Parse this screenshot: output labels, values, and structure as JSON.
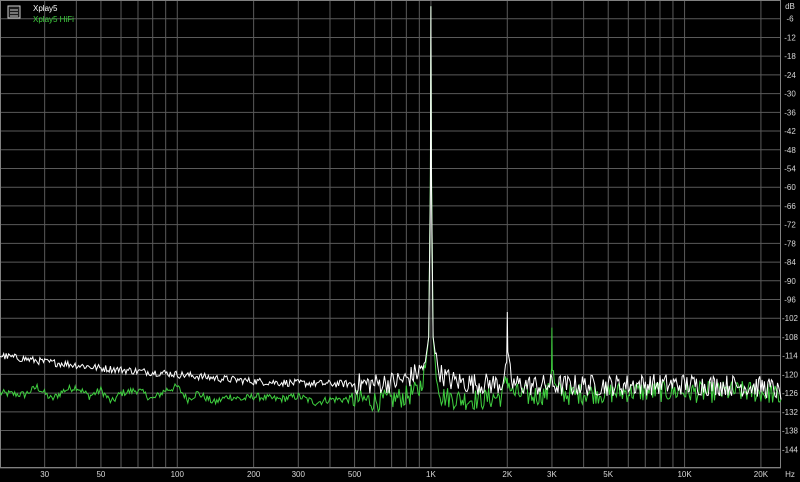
{
  "chart_data": {
    "type": "line",
    "title": "",
    "xlabel": "",
    "ylabel": "",
    "x_unit": "Hz",
    "y_unit": "dB",
    "x_scale": "log",
    "xlim": [
      20,
      24000
    ],
    "ylim": [
      -150,
      0
    ],
    "grid": true,
    "legend_position": "top-left",
    "background": "#000000",
    "y_ticks": [
      -6,
      -12,
      -18,
      -24,
      -30,
      -36,
      -42,
      -48,
      -54,
      -60,
      -66,
      -72,
      -78,
      -84,
      -90,
      -96,
      -102,
      -108,
      -114,
      -120,
      -126,
      -132,
      -138,
      -144
    ],
    "x_ticks": [
      {
        "value": 30,
        "label": "30"
      },
      {
        "value": 50,
        "label": "50"
      },
      {
        "value": 100,
        "label": "100"
      },
      {
        "value": 200,
        "label": "200"
      },
      {
        "value": 300,
        "label": "300"
      },
      {
        "value": 500,
        "label": "500"
      },
      {
        "value": 1000,
        "label": "1K"
      },
      {
        "value": 2000,
        "label": "2K"
      },
      {
        "value": 3000,
        "label": "3K"
      },
      {
        "value": 5000,
        "label": "5K"
      },
      {
        "value": 10000,
        "label": "10K"
      },
      {
        "value": 20000,
        "label": "20K"
      }
    ],
    "series": [
      {
        "name": "Xplay5",
        "color": "#ffffff",
        "x": [
          20,
          25,
          30,
          35,
          40,
          45,
          50,
          60,
          70,
          80,
          90,
          100,
          120,
          150,
          200,
          250,
          300,
          400,
          500,
          600,
          700,
          800,
          900,
          950,
          980,
          995,
          1000,
          1005,
          1020,
          1050,
          1100,
          1200,
          1500,
          1900,
          1990,
          2000,
          2010,
          2100,
          2500,
          2900,
          3000,
          3100,
          4000,
          5000,
          6000,
          8000,
          10000,
          12000,
          15000,
          18000,
          20000,
          22000,
          23000,
          24000
        ],
        "y": [
          -114,
          -115,
          -116,
          -116.5,
          -117,
          -117.5,
          -118,
          -118.5,
          -119,
          -119.3,
          -119.6,
          -120,
          -120.6,
          -121.4,
          -122.2,
          -122.6,
          -122.8,
          -123,
          -123,
          -123,
          -122.5,
          -121.5,
          -119,
          -116,
          -108,
          -60,
          -2,
          -60,
          -108,
          -116,
          -120,
          -122,
          -123,
          -123,
          -116,
          -100,
          -116,
          -123,
          -123.5,
          -123.5,
          -123,
          -123.5,
          -123.5,
          -123.5,
          -123.3,
          -123.2,
          -123.2,
          -123.4,
          -123.5,
          -123.8,
          -124,
          -124.5,
          -125,
          -128
        ]
      },
      {
        "name": "Xplay5 HiFi",
        "color": "#3fcf3f",
        "x": [
          20,
          25,
          28,
          32,
          36,
          40,
          45,
          50,
          55,
          60,
          70,
          80,
          90,
          100,
          110,
          120,
          140,
          160,
          180,
          200,
          250,
          300,
          350,
          400,
          500,
          600,
          700,
          800,
          900,
          950,
          980,
          995,
          1000,
          1005,
          1020,
          1050,
          1100,
          1300,
          1600,
          1900,
          1990,
          2000,
          2010,
          2100,
          2500,
          2900,
          2990,
          3000,
          3010,
          3100,
          3500,
          4000,
          5000,
          6000,
          8000,
          10000,
          12000,
          15000,
          18000,
          20000,
          22000,
          23000,
          24000
        ],
        "y": [
          -126,
          -126.5,
          -124,
          -128,
          -125,
          -124,
          -127,
          -125,
          -129,
          -126,
          -125,
          -128,
          -125,
          -124,
          -128,
          -126,
          -129,
          -127,
          -128,
          -127,
          -128,
          -127,
          -129,
          -128,
          -128,
          -128.5,
          -128,
          -127,
          -125,
          -118,
          -108,
          -55,
          -2,
          -55,
          -108,
          -120,
          -127,
          -128,
          -128,
          -127,
          -122,
          -121,
          -122,
          -126,
          -127,
          -126,
          -118,
          -105,
          -118,
          -125,
          -126.5,
          -126,
          -126,
          -125.5,
          -125.5,
          -125.5,
          -125.8,
          -125.5,
          -125.5,
          -125.8,
          -126,
          -127,
          -128
        ]
      }
    ]
  }
}
